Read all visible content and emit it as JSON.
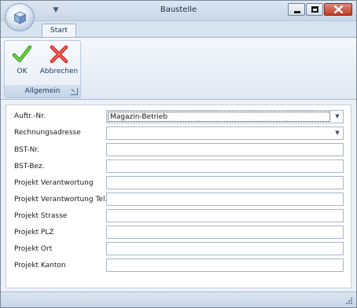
{
  "window": {
    "title": "Baustelle"
  },
  "ribbon": {
    "tab_label": "Start",
    "ok_label": "OK",
    "cancel_label": "Abbrechen",
    "group_label": "Allgemein"
  },
  "form": {
    "fields": [
      {
        "label": "Auftr.-Nr.",
        "value": "Magazin-Betrieb",
        "type": "combo"
      },
      {
        "label": "Rechnungsadresse",
        "value": "",
        "type": "combo"
      },
      {
        "label": "BST-Nr.",
        "value": "",
        "type": "text"
      },
      {
        "label": "BST-Bez.",
        "value": "",
        "type": "text"
      },
      {
        "label": "Projekt Verantwortung",
        "value": "",
        "type": "text"
      },
      {
        "label": "Projekt Verantwortung Tel.",
        "value": "",
        "type": "text"
      },
      {
        "label": "Projekt Strasse",
        "value": "",
        "type": "text"
      },
      {
        "label": "Projekt PLZ",
        "value": "",
        "type": "text"
      },
      {
        "label": "Projekt Ort",
        "value": "",
        "type": "text"
      },
      {
        "label": "Projekt Kanton",
        "value": "",
        "type": "text"
      }
    ]
  },
  "icons": {
    "app": "app-orb-icon",
    "ok": "green-check-icon",
    "cancel": "red-x-icon",
    "dropdown": "chevron-down-icon"
  },
  "colors": {
    "ok_green": "#3aa51d",
    "cancel_red": "#d8251b",
    "ribbon_blue": "#dfe8f3"
  }
}
